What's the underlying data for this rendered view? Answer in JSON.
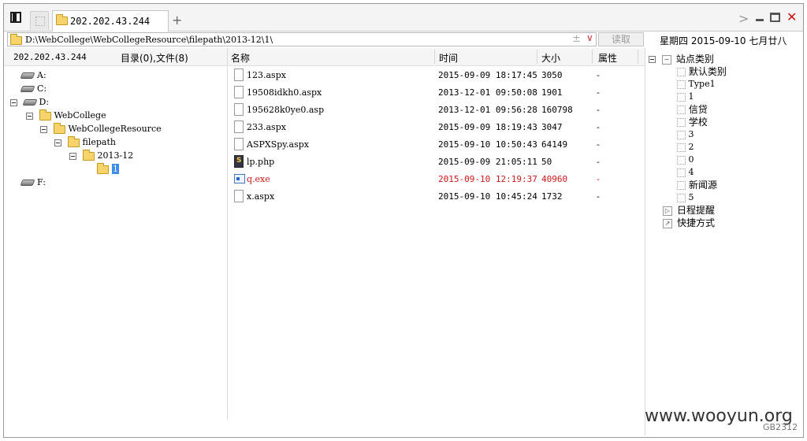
{
  "tabs": [
    {
      "label": "202.202.43.244",
      "active": true
    }
  ],
  "address_bar": {
    "path": "D:\\WebCollege\\WebCollegeResource\\filepath\\2013-12\\1\\",
    "plus_symbol": "±",
    "dropdown_symbol": "∨"
  },
  "read_button": "读取",
  "date_bar": "星期四 2015-09-10 七月廿八",
  "left_panel": {
    "host": "202.202.43.244",
    "counts": "目录(0),文件(8)"
  },
  "tree": [
    {
      "label": "A:",
      "kind": "drive"
    },
    {
      "label": "C:",
      "kind": "drive"
    },
    {
      "label": "D:",
      "kind": "drive",
      "expanded": true
    },
    {
      "label": "WebCollege",
      "kind": "folder",
      "expanded": true
    },
    {
      "label": "WebCollegeResource",
      "kind": "folder",
      "expanded": true
    },
    {
      "label": "filepath",
      "kind": "folder",
      "expanded": true
    },
    {
      "label": "2013-12",
      "kind": "folder",
      "expanded": true
    },
    {
      "label": "1",
      "kind": "folder",
      "selected": true
    },
    {
      "label": "F:",
      "kind": "drive"
    }
  ],
  "columns": {
    "name": "名称",
    "time": "时间",
    "size": "大小",
    "attr": "属性"
  },
  "files": [
    {
      "name": "123.aspx",
      "time": "2015-09-09 18:17:45",
      "size": "3050",
      "attr": "-",
      "icon": "file-icon",
      "highlight": false
    },
    {
      "name": "19508idkh0.aspx",
      "time": "2013-12-01 09:50:08",
      "size": "1901",
      "attr": "-",
      "icon": "file-icon",
      "highlight": false
    },
    {
      "name": "195628k0ye0.asp",
      "time": "2013-12-01 09:56:28",
      "size": "160798",
      "attr": "-",
      "icon": "file-icon",
      "highlight": false
    },
    {
      "name": "233.aspx",
      "time": "2015-09-09 18:19:43",
      "size": "3047",
      "attr": "-",
      "icon": "file-icon",
      "highlight": false
    },
    {
      "name": "ASPXSpy.aspx",
      "time": "2015-09-10 10:50:43",
      "size": "64149",
      "attr": "-",
      "icon": "file-icon",
      "highlight": false
    },
    {
      "name": "lp.php",
      "time": "2015-09-09 21:05:11",
      "size": "50",
      "attr": "-",
      "icon": "php-file-icon",
      "highlight": false
    },
    {
      "name": "q.exe",
      "time": "2015-09-10 12:19:37",
      "size": "40960",
      "attr": "-",
      "icon": "exe-file-icon",
      "highlight": true
    },
    {
      "name": "x.aspx",
      "time": "2015-09-10 10:45:24",
      "size": "1732",
      "attr": "-",
      "icon": "file-icon",
      "highlight": false
    }
  ],
  "right_panel": {
    "site_category": "站点类别",
    "categories": [
      "默认类别",
      "Type1",
      "1",
      "信贷",
      "学校",
      "3",
      "2",
      "0",
      "4",
      "新闻源",
      "5"
    ],
    "schedule": "日程提醒",
    "shortcuts": "快捷方式"
  },
  "watermark": {
    "site": "www.wooyun.org",
    "code": "GB2312"
  },
  "colors": {
    "highlight_red": "#d01818",
    "selection_blue": "#3d8ee8",
    "close_red": "#d01010"
  }
}
